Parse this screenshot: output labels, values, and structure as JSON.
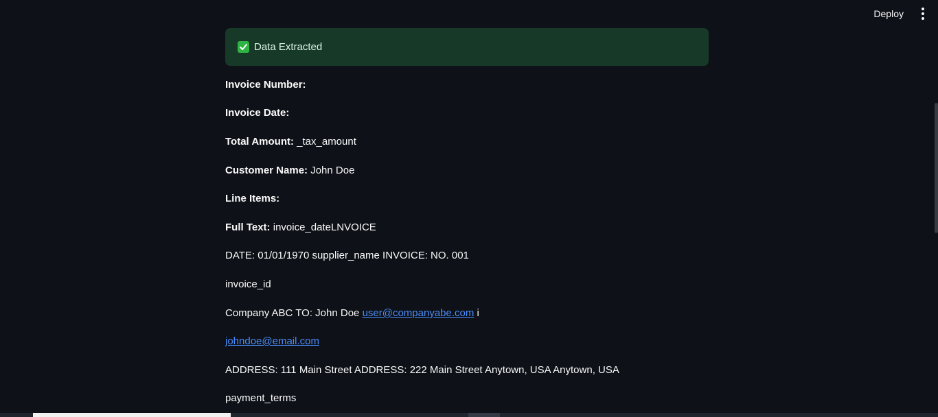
{
  "header": {
    "deploy_label": "Deploy",
    "menu_icon": "kebab-menu-icon"
  },
  "alert": {
    "icon": "check-icon",
    "text": "Data Extracted",
    "colors": {
      "background": "#173928",
      "icon": "#2fb344"
    }
  },
  "fields": {
    "invoice_number_label": "Invoice Number:",
    "invoice_number_value": "",
    "invoice_date_label": "Invoice Date:",
    "invoice_date_value": "",
    "total_amount_label": "Total Amount:",
    "total_amount_value": " _tax_amount",
    "customer_name_label": "Customer Name:",
    "customer_name_value": " John Doe",
    "line_items_label": "Line Items:",
    "line_items_value": "",
    "full_text_label": "Full Text:",
    "full_text_value": " invoice_dateLNVOICE"
  },
  "full_text_lines": {
    "line1": "DATE: 01/01/1970 supplier_name INVOICE: NO. 001",
    "line2": "invoice_id",
    "line3_prefix": "Company ABC TO: John Doe ",
    "line3_link": "user@companyabe.com",
    "line3_suffix": " i",
    "line4_link": "johndoe@email.com",
    "line5": "ADDRESS: 111 Main Street ADDRESS: 222 Main Street Anytown, USA Anytown, USA",
    "line6": "payment_terms"
  },
  "colors": {
    "background": "#0e1117",
    "text": "#fafafa",
    "link": "#4a8dfc"
  }
}
